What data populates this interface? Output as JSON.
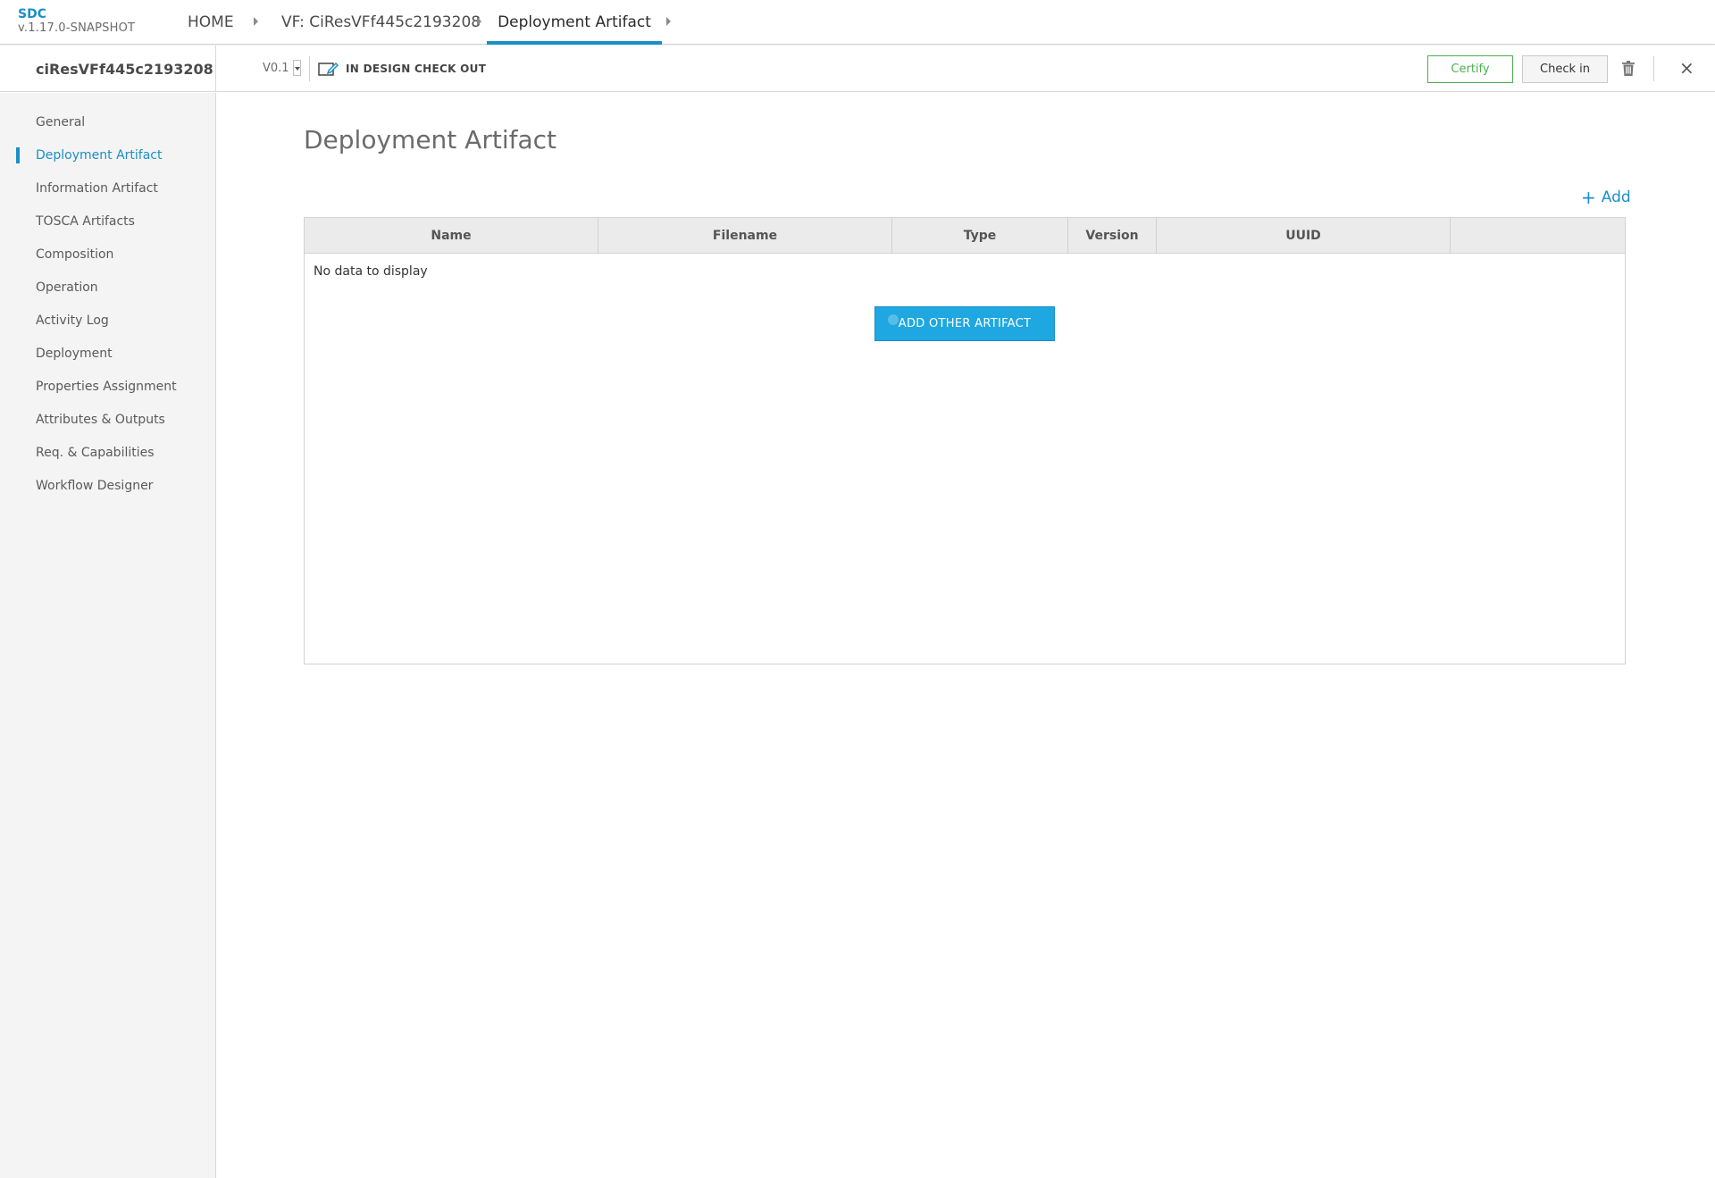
{
  "header": {
    "app_name": "SDC",
    "app_version": "v.1.17.0-SNAPSHOT",
    "breadcrumbs": [
      "HOME",
      "VF: CiResVFf445c2193208",
      "Deployment Artifact"
    ]
  },
  "toolbar": {
    "resource_name": "ciResVFf445c2193208",
    "version": "V0.1",
    "status": "IN DESIGN CHECK OUT",
    "certify_label": "Certify",
    "checkin_label": "Check in",
    "close_label": "×"
  },
  "sidebar": {
    "items": [
      {
        "label": "General"
      },
      {
        "label": "Deployment Artifact",
        "active": true
      },
      {
        "label": "Information Artifact"
      },
      {
        "label": "TOSCA Artifacts"
      },
      {
        "label": "Composition"
      },
      {
        "label": "Operation"
      },
      {
        "label": "Activity Log"
      },
      {
        "label": "Deployment"
      },
      {
        "label": "Properties Assignment"
      },
      {
        "label": "Attributes & Outputs"
      },
      {
        "label": "Req. & Capabilities"
      },
      {
        "label": "Workflow Designer"
      }
    ]
  },
  "main": {
    "title": "Deployment Artifact",
    "add_label": "Add",
    "add_symbol": "+",
    "table": {
      "columns": [
        "Name",
        "Filename",
        "Type",
        "Version",
        "UUID",
        ""
      ],
      "empty_text": "No data to display"
    },
    "add_other_label": "ADD OTHER ARTIFACT"
  },
  "colors": {
    "accent": "#1b8fc9",
    "certify": "#4caf50",
    "button_primary": "#1ea7e1"
  }
}
